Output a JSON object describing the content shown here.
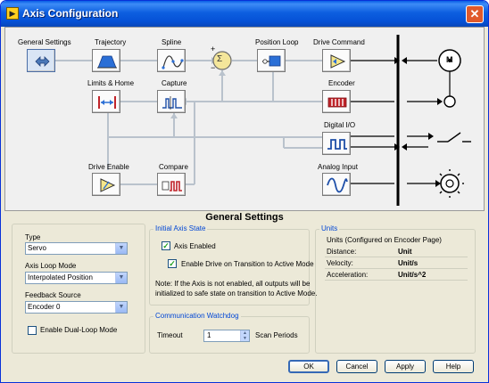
{
  "window": {
    "title": "Axis Configuration",
    "close_glyph": "✕",
    "icon": "labview-icon"
  },
  "diagram": {
    "blocks": [
      {
        "id": "general-settings",
        "label": "General Settings",
        "icon": "gear-arrows-icon"
      },
      {
        "id": "trajectory",
        "label": "Trajectory",
        "icon": "trapezoid-profile-icon"
      },
      {
        "id": "spline",
        "label": "Spline",
        "icon": "spline-curve-icon"
      },
      {
        "id": "position-loop",
        "label": "Position Loop",
        "icon": "pid-loop-icon"
      },
      {
        "id": "drive-command",
        "label": "Drive Command",
        "icon": "amplifier-icon"
      },
      {
        "id": "limits-home",
        "label": "Limits & Home",
        "icon": "limit-switch-icon"
      },
      {
        "id": "capture",
        "label": "Capture",
        "icon": "capture-pulse-icon"
      },
      {
        "id": "encoder",
        "label": "Encoder",
        "icon": "encoder-icon"
      },
      {
        "id": "digital-io",
        "label": "Digital I/O",
        "icon": "square-wave-icon"
      },
      {
        "id": "drive-enable",
        "label": "Drive Enable",
        "icon": "drive-enable-icon"
      },
      {
        "id": "compare",
        "label": "Compare",
        "icon": "compare-pulse-icon"
      },
      {
        "id": "analog-input",
        "label": "Analog Input",
        "icon": "sine-wave-icon"
      }
    ],
    "summing_glyph": "Σ",
    "plus": "+",
    "minus": "−",
    "motor_letter": "M"
  },
  "settings": {
    "heading": "General Settings",
    "type": {
      "label": "Type",
      "value": "Servo"
    },
    "loop_mode": {
      "label": "Axis Loop Mode",
      "value": "Interpolated Position"
    },
    "feedback": {
      "label": "Feedback Source",
      "value": "Encoder 0"
    },
    "dual_loop": {
      "label": "Enable Dual-Loop Mode",
      "checked": false
    },
    "initial_state": {
      "legend": "Initial Axis State",
      "axis_enabled": {
        "label": "Axis Enabled",
        "checked": true
      },
      "enable_drive": {
        "label": "Enable Drive on Transition to Active Mode",
        "checked": true
      },
      "note_line1": "Note: If the Axis is not enabled, all outputs will be",
      "note_line2": "initialized to safe state on transition to Active Mode."
    },
    "watchdog": {
      "legend": "Communication Watchdog",
      "timeout_label": "Timeout",
      "timeout_value": "1",
      "units": "Scan Periods"
    },
    "units": {
      "legend": "Units",
      "caption": "Units (Configured on Encoder Page)",
      "rows": [
        {
          "name": "Distance:",
          "value": "Unit"
        },
        {
          "name": "Velocity:",
          "value": "Unit/s"
        },
        {
          "name": "Acceleration:",
          "value": "Unit/s^2"
        }
      ]
    }
  },
  "buttons": {
    "ok": "OK",
    "cancel": "Cancel",
    "apply": "Apply",
    "help": "Help"
  }
}
